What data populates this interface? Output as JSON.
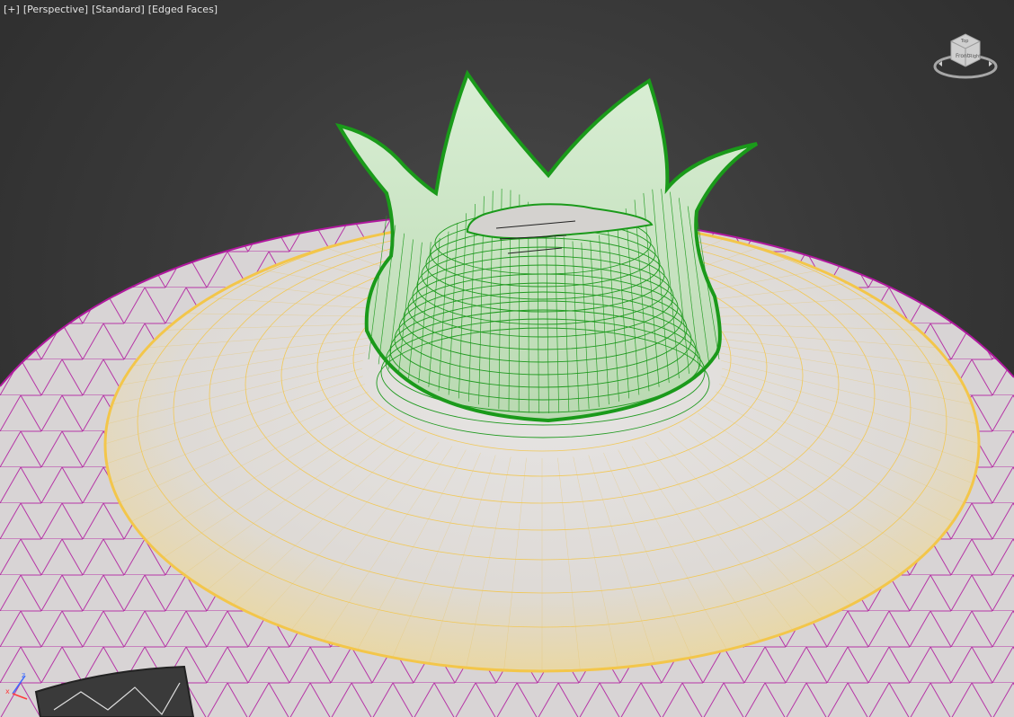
{
  "viewport": {
    "label_items": [
      "[+]",
      "[Perspective]",
      "[Standard]",
      "[Edged Faces]"
    ]
  },
  "viewcube": {
    "face_labels": {
      "front": "Front",
      "right": "Right",
      "top": "Top"
    },
    "icon": "viewcube-icon"
  },
  "axis_tripod": {
    "x_label": "x",
    "z_label": "z"
  },
  "colors": {
    "background": "#333333",
    "body_shade": "#d7d3d4",
    "selection_wire_magenta": "#b0189e",
    "cap_fill": "#ece2c6",
    "cap_wire_yellow": "#f3c64a",
    "crown_fill": "#cfe6c8",
    "crown_wire_green": "#1a9a1a",
    "text": "#e2e2e2"
  }
}
